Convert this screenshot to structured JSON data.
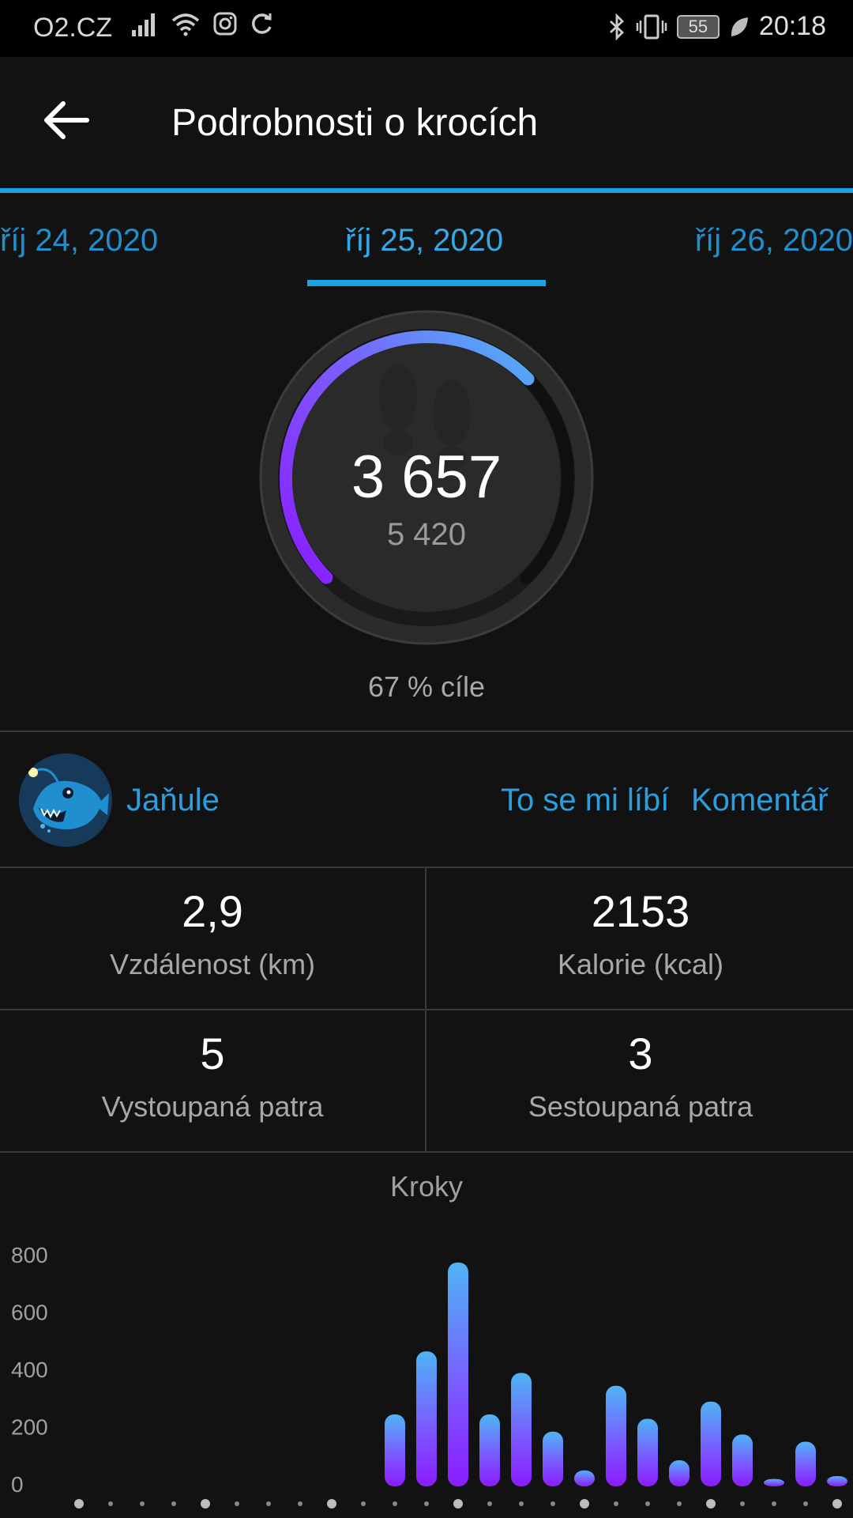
{
  "status_bar": {
    "carrier": "O2.CZ",
    "battery": "55",
    "time": "20:18"
  },
  "app_bar": {
    "title": "Podrobnosti o krocích",
    "back_icon": "arrow-left-icon"
  },
  "date_tabs": {
    "prev": "říj 24, 2020",
    "current": "říj 25, 2020",
    "next": "říj 26, 2020"
  },
  "ring": {
    "steps": "3 657",
    "goal": "5 420",
    "progress": 0.67,
    "percent_text": "67 % cíle"
  },
  "social": {
    "user": "Jaňule",
    "like": "To se mi líbí",
    "comment": "Komentář"
  },
  "stats": [
    {
      "value": "2,9",
      "label": "Vzdálenost (km)"
    },
    {
      "value": "2153",
      "label": "Kalorie (kcal)"
    },
    {
      "value": "5",
      "label": "Vystoupaná patra"
    },
    {
      "value": "3",
      "label": "Sestoupaná patra"
    }
  ],
  "colors": {
    "accent": "#1ea1e0",
    "bar_bottom": "#8a1cff",
    "bar_top": "#4fb4f5",
    "background": "#121212"
  },
  "chart_data": {
    "type": "bar",
    "title": "Kroky",
    "y_ticks": [
      "800",
      "600",
      "400",
      "200",
      "0"
    ],
    "ylim": [
      0,
      800
    ],
    "slots": 24,
    "values": [
      0,
      0,
      0,
      0,
      0,
      0,
      0,
      0,
      0,
      0,
      240,
      460,
      770,
      240,
      385,
      180,
      45,
      340,
      225,
      80,
      285,
      170,
      15,
      145,
      25
    ]
  }
}
